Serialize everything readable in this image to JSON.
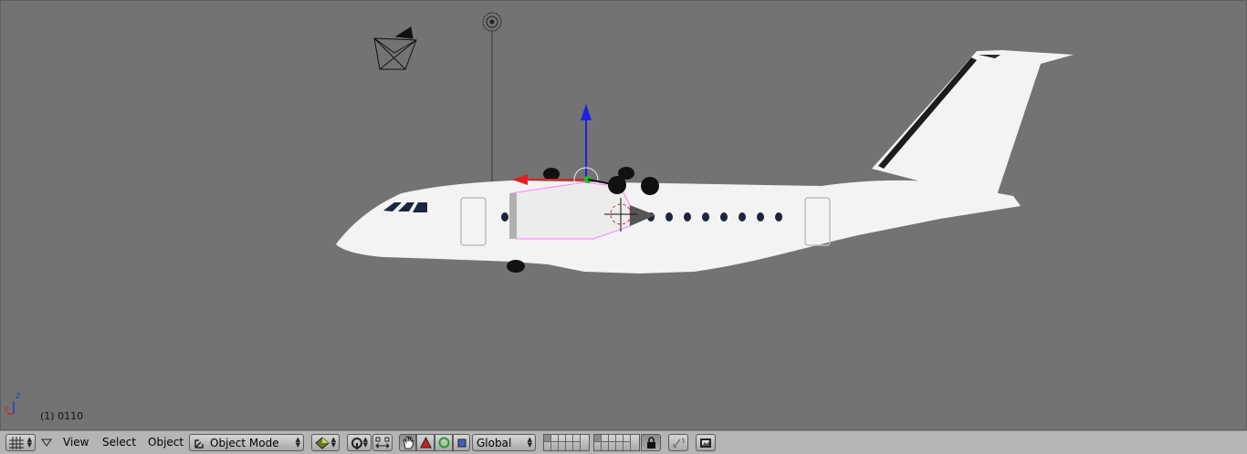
{
  "viewport": {
    "frame_label": "(1) 0110",
    "axis_x": "X",
    "axis_z": "Z"
  },
  "header": {
    "menus": {
      "view": "View",
      "select": "Select",
      "object": "Object"
    },
    "mode_select": "Object Mode",
    "orientation_select": "Global"
  },
  "colors": {
    "viewport_bg": "#737373",
    "header_bg": "#b5b5b5",
    "manipulator_x": "#e02020",
    "manipulator_z": "#2020e0",
    "selection_outline": "#ff80ff"
  },
  "icons": {
    "editor_type": "grid-icon",
    "pivot": "pivot-icon",
    "manipulator_hand": "hand-icon",
    "translate": "translate-icon",
    "rotate": "rotate-icon",
    "scale": "scale-icon",
    "layer_lock": "lock-icon",
    "render": "render-icon"
  }
}
